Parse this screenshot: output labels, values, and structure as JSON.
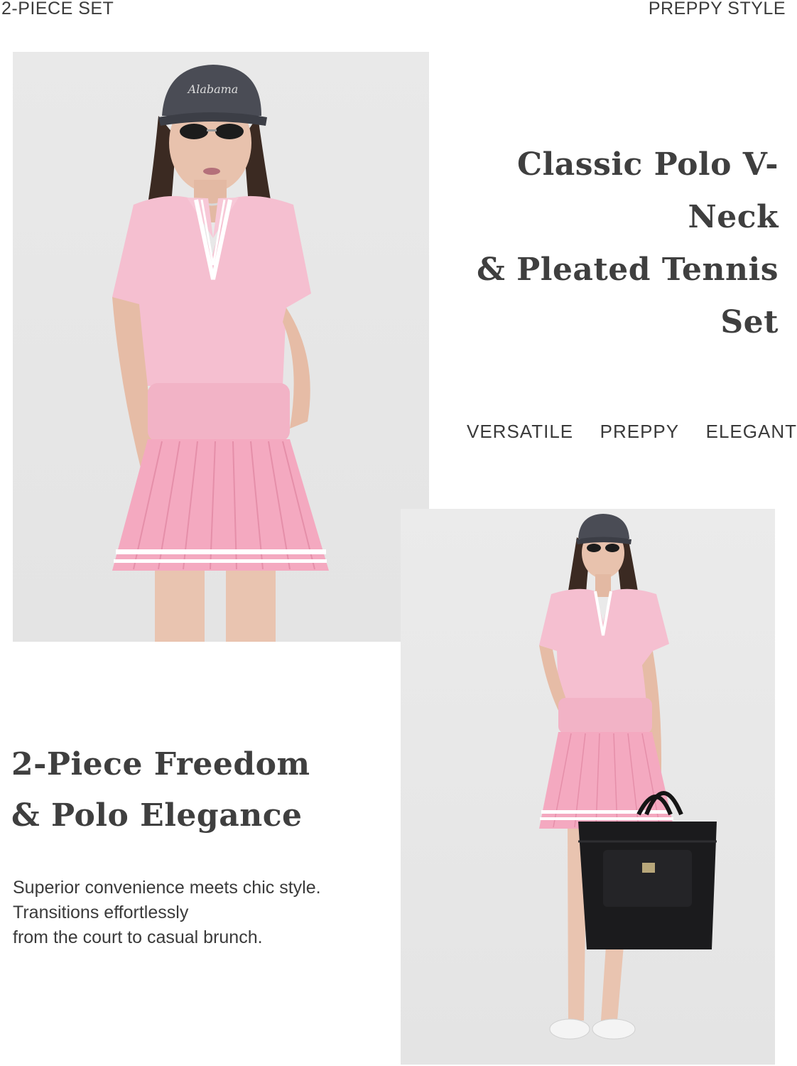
{
  "header": {
    "left_label": "2-PIECE SET",
    "right_label": "PREPPY STYLE"
  },
  "hero": {
    "headline_line1": "Classic Polo V-Neck",
    "headline_line2": "& Pleated Tennis Set"
  },
  "tags": [
    "VERSATILE",
    "PREPPY",
    "ELEGANT"
  ],
  "feature": {
    "headline_line1": "2-Piece Freedom",
    "headline_line2": "& Polo Elegance",
    "description": [
      "Superior convenience meets chic style.",
      "Transitions effortlessly",
      "from the court to casual brunch."
    ]
  },
  "cap_text": "Alabama",
  "colors": {
    "background": "#ffffff",
    "photo_backdrop": "#e7e7e7",
    "polo_pink": "#f5bfd0",
    "skirt_pink": "#f4a9c0",
    "text": "#3a3a3a"
  }
}
